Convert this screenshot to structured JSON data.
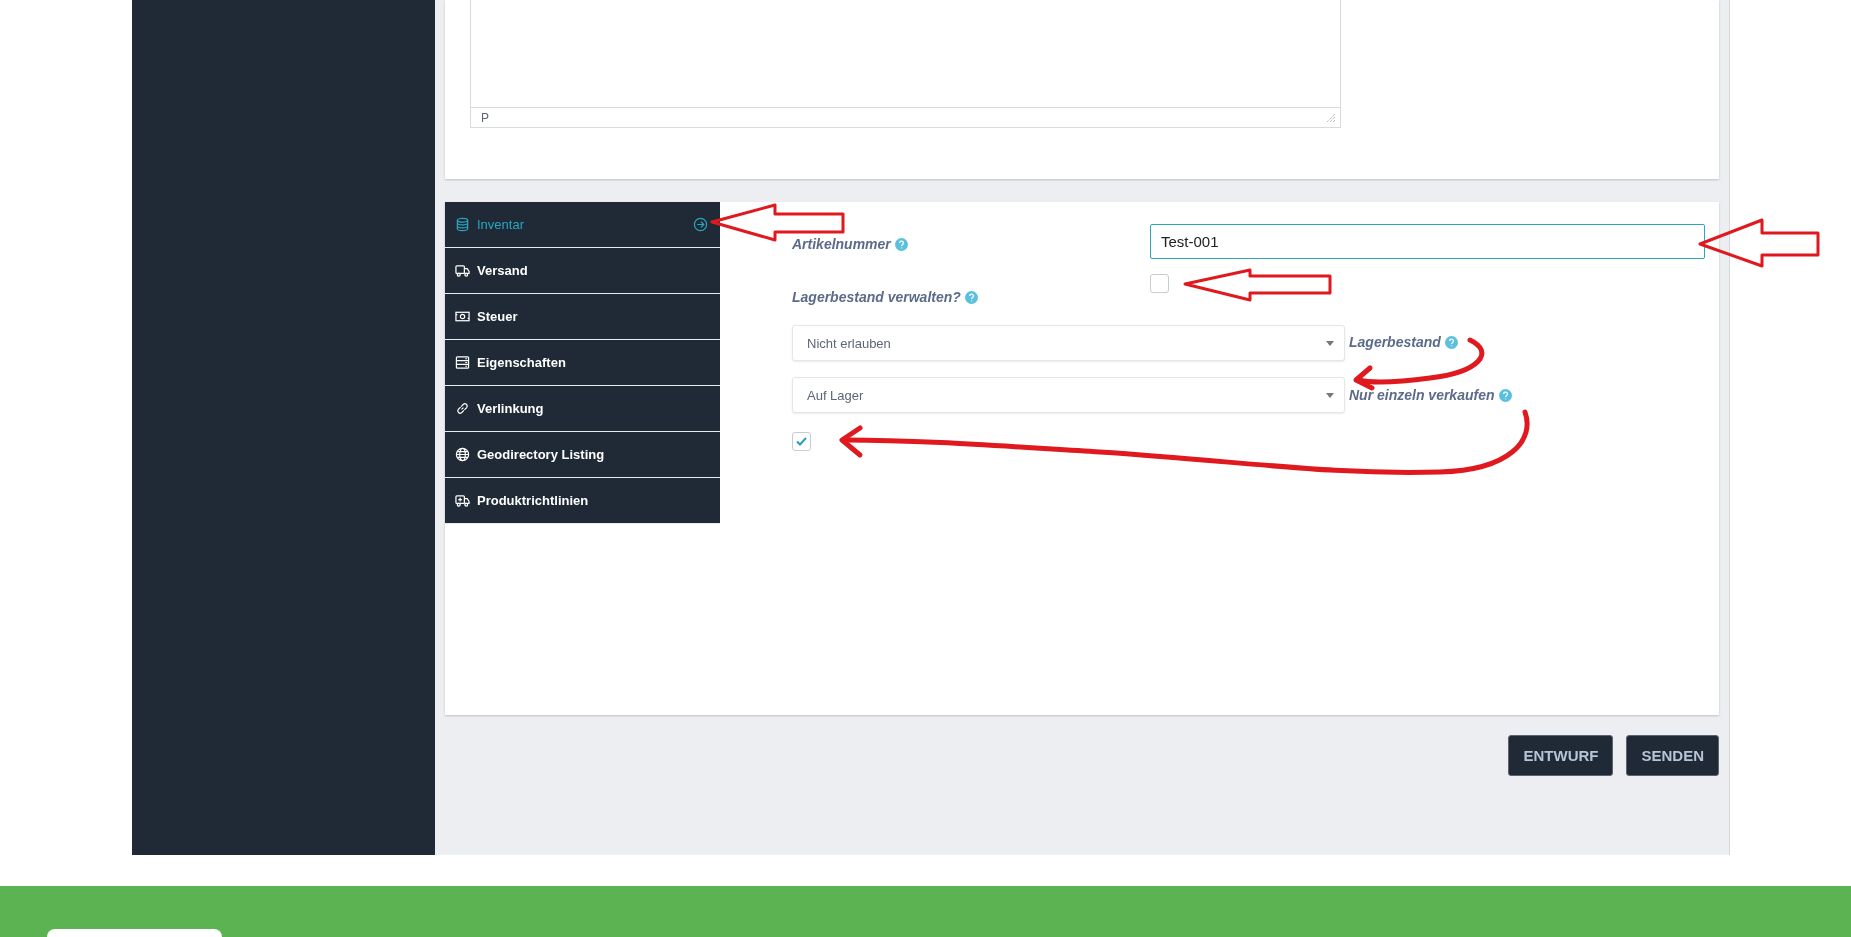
{
  "editor": {
    "status_path": "P"
  },
  "tabs": [
    {
      "label": "Inventar",
      "selected": true
    },
    {
      "label": "Versand",
      "selected": false
    },
    {
      "label": "Steuer",
      "selected": false
    },
    {
      "label": "Eigenschaften",
      "selected": false
    },
    {
      "label": "Verlinkung",
      "selected": false
    },
    {
      "label": "Geodirectory Listing",
      "selected": false
    },
    {
      "label": "Produktrichtlinien",
      "selected": false
    }
  ],
  "inventory_form": {
    "sku": {
      "label": "Artikelnummer",
      "value": "Test-001"
    },
    "manage_stock": {
      "label": "Lagerbestand verwalten?",
      "checked": false
    },
    "backorders_select": {
      "value": "Nicht erlauben"
    },
    "stock_label": "Lagerbestand",
    "stock_status_select": {
      "value": "Auf Lager"
    },
    "sold_individually": {
      "label": "Nur einzeln verkaufen",
      "checked": true
    }
  },
  "buttons": [
    {
      "label": "ENTWURF"
    },
    {
      "label": "SENDEN"
    }
  ]
}
